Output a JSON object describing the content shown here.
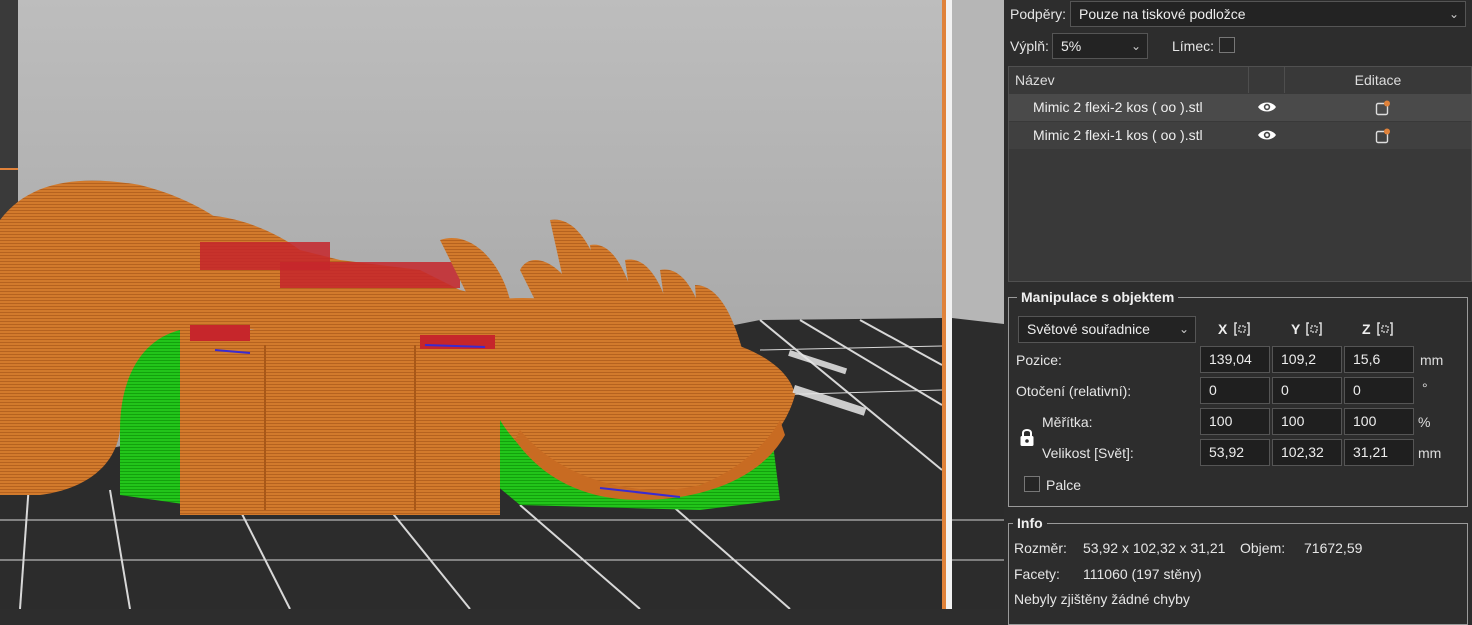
{
  "print_settings": {
    "supports_label": "Podpěry:",
    "supports_value": "Pouze na tiskové podložce",
    "infill_label": "Výplň:",
    "infill_value": "5%",
    "brim_label": "Límec:"
  },
  "object_list": {
    "col_name": "Název",
    "col_edit": "Editace",
    "rows": [
      {
        "name": "Mimic 2 flexi-2 kos ( oo ).stl"
      },
      {
        "name": "Mimic 2 flexi-1 kos ( oo ).stl"
      }
    ]
  },
  "manipulation": {
    "title": "Manipulace s objektem",
    "coord_system": "Světové souřadnice",
    "axes": [
      "X",
      "Y",
      "Z"
    ],
    "position": {
      "label": "Pozice:",
      "x": "139,04",
      "y": "109,2",
      "z": "15,6",
      "unit": "mm"
    },
    "rotation": {
      "label": "Otočení (relativní):",
      "x": "0",
      "y": "0",
      "z": "0",
      "unit": "°"
    },
    "scale": {
      "label": "Měřítka:",
      "x": "100",
      "y": "100",
      "z": "100",
      "unit": "%"
    },
    "size": {
      "label": "Velikost [Svět]:",
      "x": "53,92",
      "y": "102,32",
      "z": "31,21",
      "unit": "mm"
    },
    "inches_label": "Palce"
  },
  "info": {
    "title": "Info",
    "size_label": "Rozměr:",
    "size_value": "53,92 x 102,32 x 31,21",
    "volume_label": "Objem:",
    "volume_value": "71672,59",
    "facets_label": "Facety:",
    "facets_value": "111060 (197 stěny)",
    "errors_text": "Nebyly zjištěny žádné chyby"
  },
  "colors": {
    "accent": "#e0823a",
    "model": "#d27a2c",
    "support": "#22c41a",
    "bed": "#2c2c2c",
    "background_top": "#b9b9b9"
  },
  "icons": [
    "eye-icon",
    "edit-icon",
    "lock-icon",
    "drop-to-bed-icon",
    "chevron-down-icon"
  ]
}
